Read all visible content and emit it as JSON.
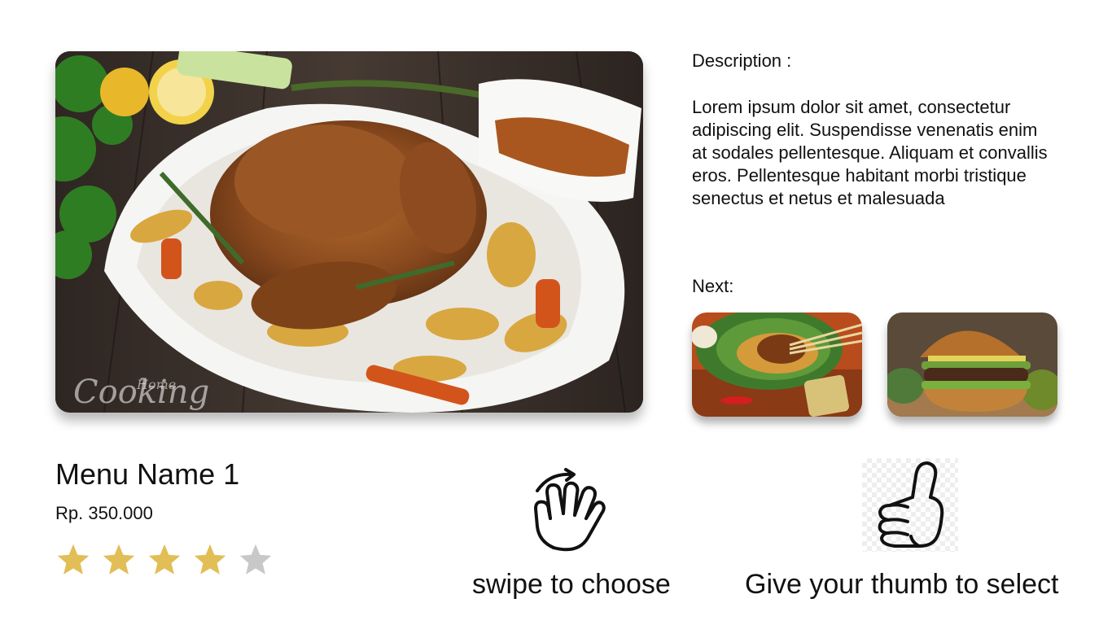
{
  "description": {
    "title": "Description :",
    "body": "Lorem ipsum dolor sit amet, consectetur adipiscing elit. Suspendisse venenatis enim at sodales pellentesque. Aliquam et convallis eros. Pellentesque habitant morbi tristique senectus et netus et malesuada"
  },
  "next": {
    "title": "Next:"
  },
  "hero": {
    "watermark_line1": "Home",
    "watermark_line2": "Cooking"
  },
  "menu": {
    "name": "Menu Name 1",
    "price": "Rp. 350.000",
    "rating": 4,
    "rating_max": 5,
    "star_color_filled": "#E2BE57",
    "star_color_empty": "#C8C8C8"
  },
  "gestures": {
    "swipe_label": "swipe to choose",
    "thumb_label": "Give your thumb to select",
    "swipe_icon": "swipe-hand-icon",
    "thumb_icon": "thumbs-up-icon"
  }
}
